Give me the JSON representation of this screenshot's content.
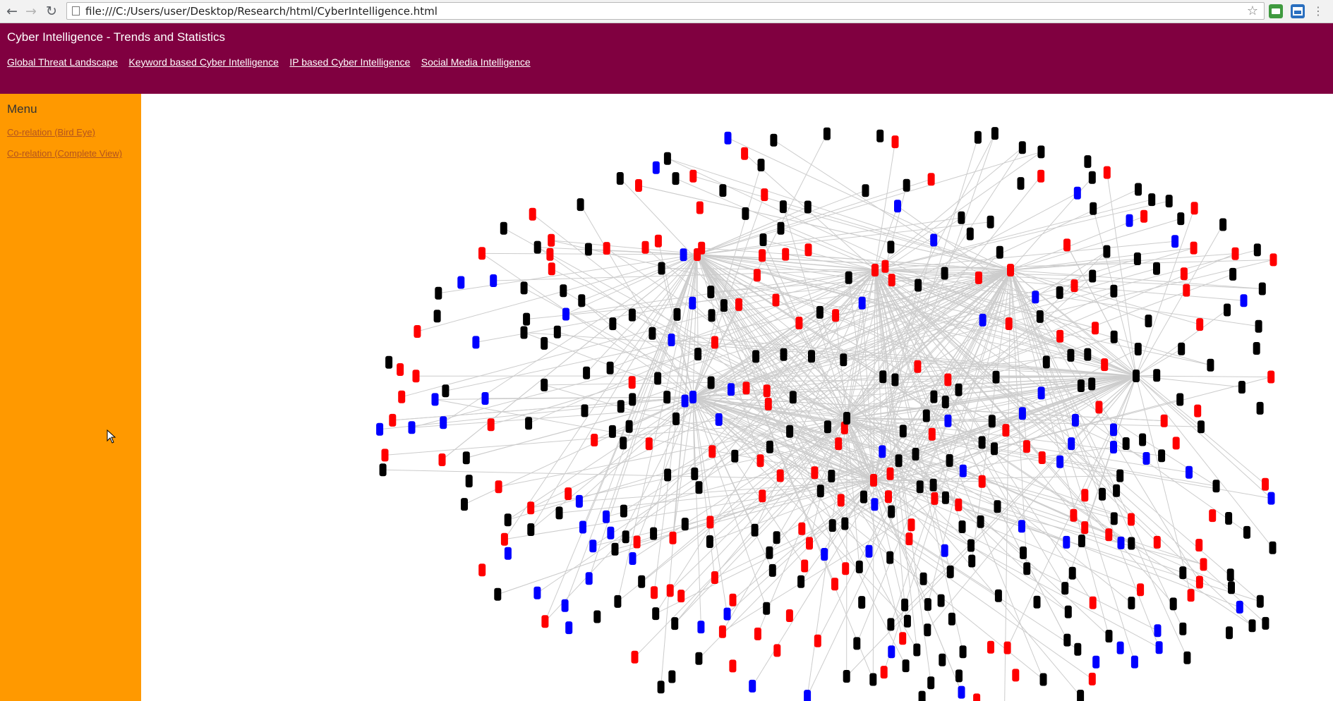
{
  "browser": {
    "back_icon": "arrow-left-icon",
    "forward_icon": "arrow-right-icon",
    "reload_icon": "reload-icon",
    "url": "file:///C:/Users/user/Desktop/Research/html/CyberIntelligence.html",
    "bookmark_icon": "star-icon",
    "extension_icons": [
      "print-extension-icon",
      "window-extension-icon",
      "menu-more-icon"
    ]
  },
  "header": {
    "title": "Cyber Intelligence - Trends and Statistics",
    "background_color": "#800040",
    "nav": [
      "Global Threat Landscape",
      "Keyword based Cyber Intelligence",
      "IP based Cyber Intelligence",
      "Social Media Intelligence"
    ]
  },
  "sidebar": {
    "title": "Menu",
    "background_color": "#ff9900",
    "links": [
      "Co-relation (Bird Eye)",
      "Co-relation (Complete View)"
    ]
  },
  "graph": {
    "node_colors": {
      "primary": "#000000",
      "secondary": "#ff0000",
      "tertiary": "#0000ff"
    },
    "edge_color": "#cccccc"
  }
}
